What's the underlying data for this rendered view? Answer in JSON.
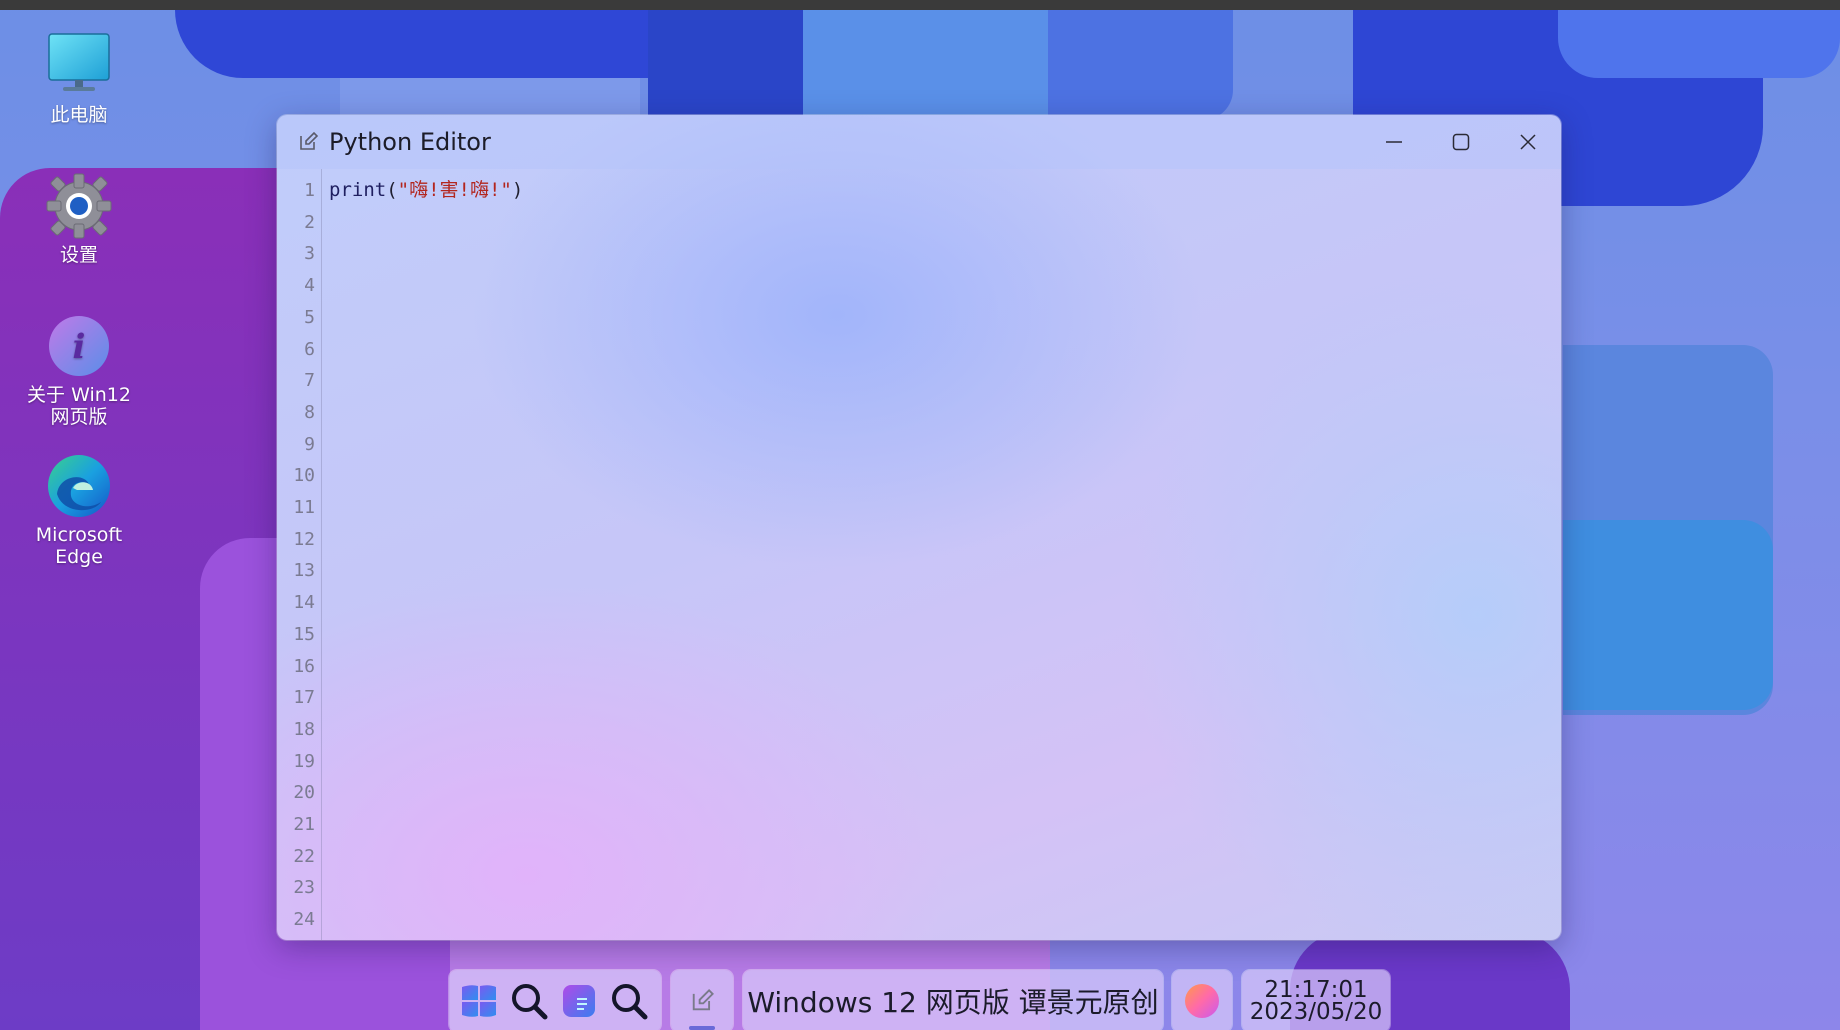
{
  "desktop": {
    "icons": [
      {
        "label": "此电脑"
      },
      {
        "label": "设置"
      },
      {
        "label": "关于 Win12\n网页版"
      },
      {
        "label": "Microsoft\nEdge"
      }
    ]
  },
  "window": {
    "title": "Python Editor",
    "code_line": {
      "fn": "print",
      "open": "(",
      "string": "\"嗨!害!嗨!\"",
      "close": ")"
    },
    "line_numbers": [
      "1",
      "2",
      "3",
      "4",
      "5",
      "6",
      "7",
      "8",
      "9",
      "10",
      "11",
      "12",
      "13",
      "14",
      "15",
      "16",
      "17",
      "18",
      "19",
      "20",
      "21",
      "22",
      "23",
      "24"
    ]
  },
  "taskbar": {
    "banner": "Windows 12 网页版 谭景元原创",
    "clock_time": "21:17:01",
    "clock_date": "2023/05/20"
  }
}
